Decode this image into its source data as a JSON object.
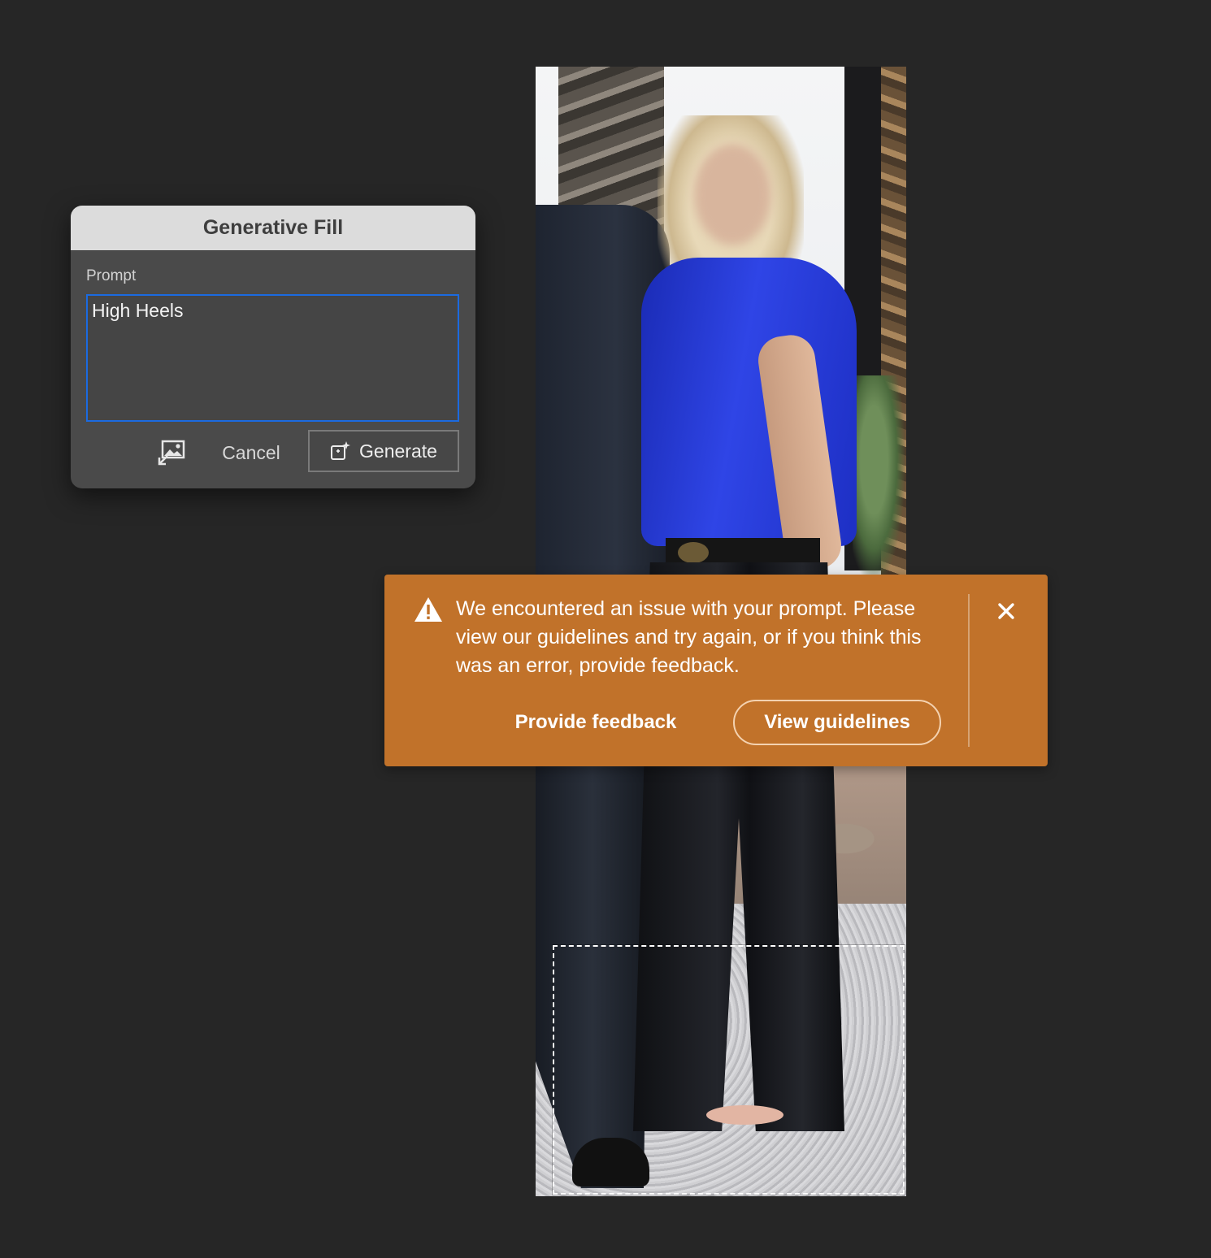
{
  "dialog": {
    "title": "Generative Fill",
    "prompt_label": "Prompt",
    "prompt_value": "High Heels",
    "cancel_label": "Cancel",
    "generate_label": "Generate"
  },
  "toast": {
    "message": "We encountered an issue with your prompt. Please view our guidelines and try again, or if you think this was an error, provide feedback.",
    "feedback_label": "Provide feedback",
    "guidelines_label": "View guidelines",
    "color": "#c1722a"
  },
  "icons": {
    "reference_image": "reference-image-icon",
    "generate": "generate-sparkle-icon",
    "warning": "warning-icon",
    "close": "close-icon"
  },
  "colors": {
    "background": "#262626",
    "input_focus": "#1b6ae0"
  }
}
